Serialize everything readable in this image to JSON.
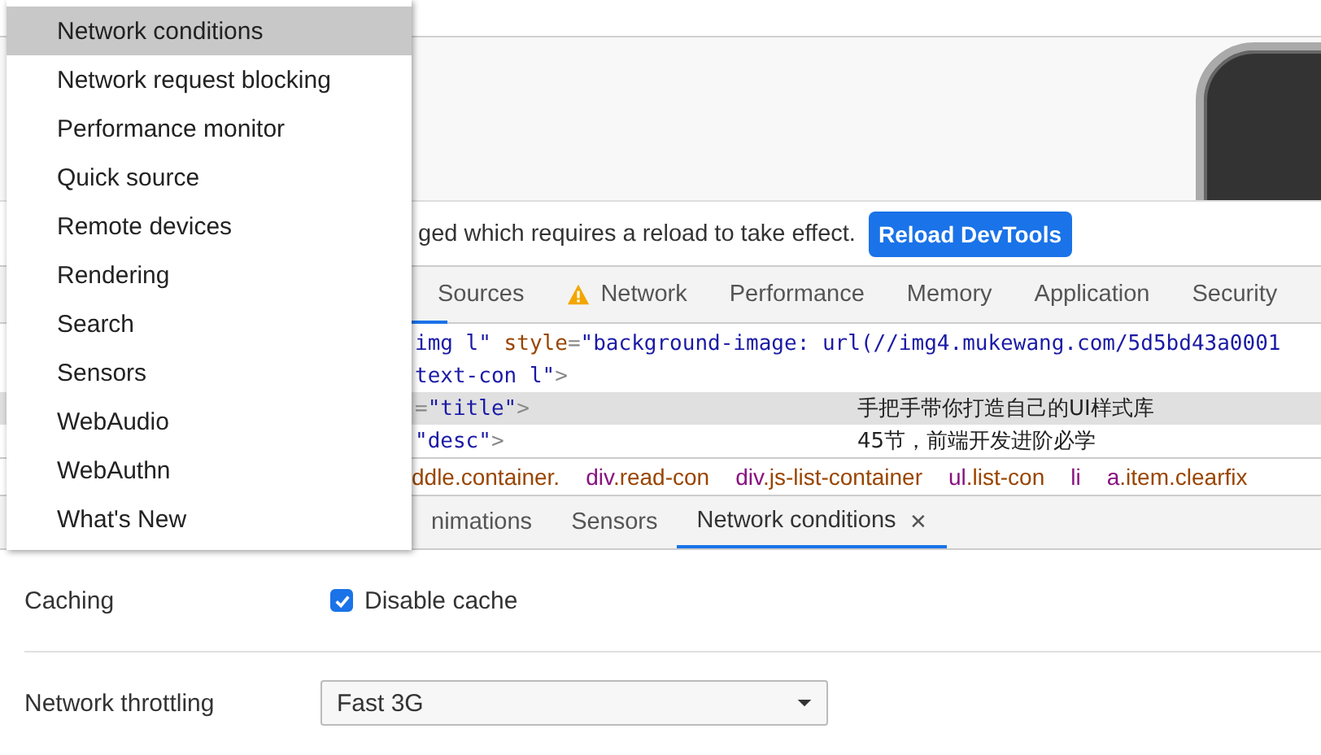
{
  "menu": {
    "items": [
      {
        "label": "Network conditions",
        "selected": true
      },
      {
        "label": "Network request blocking",
        "selected": false
      },
      {
        "label": "Performance monitor",
        "selected": false
      },
      {
        "label": "Quick source",
        "selected": false
      },
      {
        "label": "Remote devices",
        "selected": false
      },
      {
        "label": "Rendering",
        "selected": false
      },
      {
        "label": "Search",
        "selected": false
      },
      {
        "label": "Sensors",
        "selected": false
      },
      {
        "label": "WebAudio",
        "selected": false
      },
      {
        "label": "WebAuthn",
        "selected": false
      },
      {
        "label": "What's New",
        "selected": false
      }
    ]
  },
  "infobar": {
    "message": "ged which requires a reload to take effect.",
    "button": "Reload DevTools"
  },
  "main_tabs": [
    {
      "label": "Sources",
      "selected": false,
      "warning": false
    },
    {
      "label": "Network",
      "selected": false,
      "warning": true
    },
    {
      "label": "Performance",
      "selected": false,
      "warning": false
    },
    {
      "label": "Memory",
      "selected": false,
      "warning": false
    },
    {
      "label": "Application",
      "selected": false,
      "warning": false
    },
    {
      "label": "Security",
      "selected": false,
      "warning": false
    }
  ],
  "code_lines": [
    {
      "highlighted": false,
      "tokens": [
        {
          "kind": "value",
          "text": "img l\""
        },
        {
          "kind": "name",
          "text": " style"
        },
        {
          "kind": "punct",
          "text": "="
        },
        {
          "kind": "value",
          "text": "\"background-image: url(//img4.mukewang.com/5d5bd43a0001"
        }
      ]
    },
    {
      "highlighted": false,
      "tokens": [
        {
          "kind": "value",
          "text": "text-con l\""
        },
        {
          "kind": "punct",
          "text": ">"
        }
      ]
    },
    {
      "highlighted": true,
      "tokens": [
        {
          "kind": "punct",
          "text": "="
        },
        {
          "kind": "value",
          "text": "\"title\""
        },
        {
          "kind": "punct",
          "text": ">"
        }
      ],
      "content": "手把手带你打造自己的UI样式库"
    },
    {
      "highlighted": false,
      "tokens": [
        {
          "kind": "value",
          "text": "\"desc\""
        },
        {
          "kind": "punct",
          "text": ">"
        }
      ],
      "content": "45节，前端开发进阶必学"
    }
  ],
  "breadcrumbs": [
    {
      "classes": "ddle.container."
    },
    {
      "tag": "div",
      "classes": ".read-con"
    },
    {
      "tag": "div",
      "classes": ".js-list-container"
    },
    {
      "tag": "ul",
      "classes": ".list-con"
    },
    {
      "tag": "li"
    },
    {
      "tag": "a",
      "classes": ".item.clearfix"
    }
  ],
  "drawer_tabs": [
    {
      "label": "nimations",
      "selected": false,
      "closable": false
    },
    {
      "label": "Sensors",
      "selected": false,
      "closable": false
    },
    {
      "label": "Network conditions",
      "selected": true,
      "closable": true
    }
  ],
  "close_glyph": "✕",
  "caching": {
    "label": "Caching",
    "checkbox_label": "Disable cache",
    "checked": true
  },
  "throttling": {
    "label": "Network throttling",
    "value": "Fast 3G"
  }
}
